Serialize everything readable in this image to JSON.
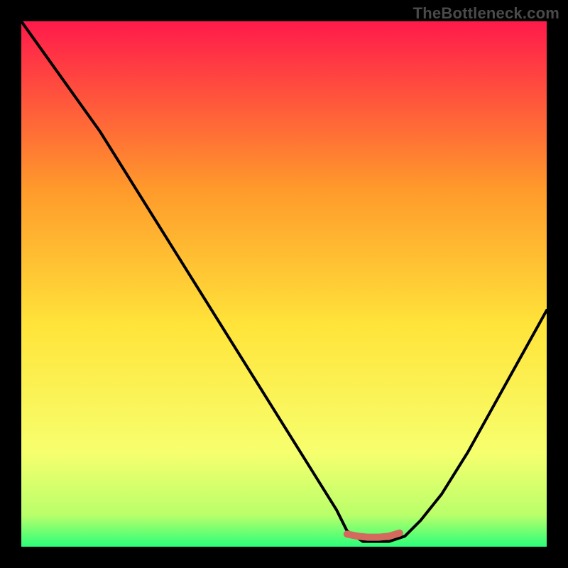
{
  "watermark": "TheBottleneck.com",
  "colors": {
    "frame": "#000000",
    "gradient_top": "#ff1a4b",
    "gradient_mid1": "#ff9a2b",
    "gradient_mid2": "#ffe43a",
    "gradient_low": "#f7ff6e",
    "gradient_bottom": "#2bff79",
    "curve_main": "#000000",
    "curve_mark": "#d46a5d"
  },
  "chart_data": {
    "type": "line",
    "title": "",
    "xlabel": "",
    "ylabel": "",
    "xlim": [
      0,
      100
    ],
    "ylim": [
      0,
      100
    ],
    "series": [
      {
        "name": "bottleneck-curve",
        "x": [
          0,
          5,
          10,
          15,
          20,
          25,
          30,
          35,
          40,
          45,
          50,
          55,
          60,
          62,
          65,
          67,
          70,
          73,
          76,
          80,
          85,
          90,
          95,
          100
        ],
        "values": [
          100,
          93,
          86,
          79,
          71,
          63,
          55,
          47,
          39,
          31,
          23,
          15,
          7,
          3,
          1,
          1,
          1,
          2,
          5,
          10,
          18,
          27,
          36,
          45
        ]
      },
      {
        "name": "optimal-mark",
        "x": [
          62,
          64,
          66,
          68,
          70,
          72
        ],
        "values": [
          2.4,
          2.0,
          1.8,
          1.8,
          2.0,
          2.6
        ]
      }
    ],
    "gradient_stops": [
      {
        "pos": 0.0,
        "color": "#ff1a4b"
      },
      {
        "pos": 0.32,
        "color": "#ff9a2b"
      },
      {
        "pos": 0.58,
        "color": "#ffe43a"
      },
      {
        "pos": 0.82,
        "color": "#f7ff6e"
      },
      {
        "pos": 0.94,
        "color": "#b9ff6a"
      },
      {
        "pos": 1.0,
        "color": "#2bff79"
      }
    ]
  }
}
